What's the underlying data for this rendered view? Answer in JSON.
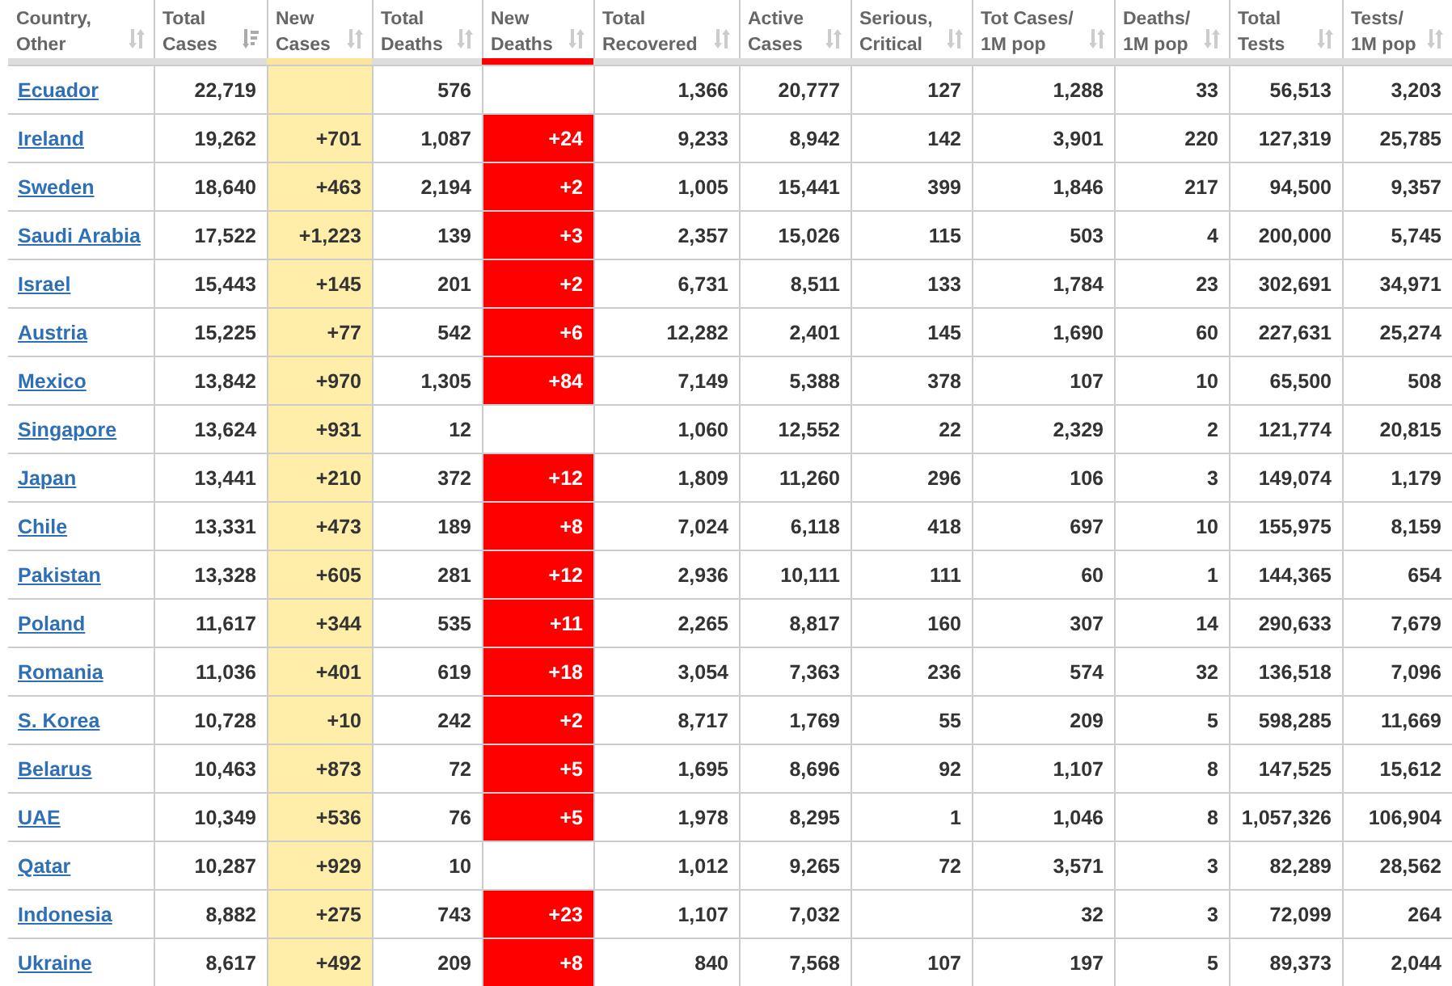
{
  "table": {
    "columns": [
      {
        "label": [
          "Country,",
          "Other"
        ],
        "kind": "country",
        "sorted": false
      },
      {
        "label": [
          "Total",
          "Cases"
        ],
        "kind": "number",
        "sorted": true
      },
      {
        "label": [
          "New",
          "Cases"
        ],
        "kind": "new_cases",
        "sorted": false
      },
      {
        "label": [
          "Total",
          "Deaths"
        ],
        "kind": "number",
        "sorted": false
      },
      {
        "label": [
          "New",
          "Deaths"
        ],
        "kind": "new_deaths",
        "sorted": false
      },
      {
        "label": [
          "Total",
          "Recovered"
        ],
        "kind": "number",
        "sorted": false
      },
      {
        "label": [
          "Active",
          "Cases"
        ],
        "kind": "number",
        "sorted": false
      },
      {
        "label": [
          "Serious,",
          "Critical"
        ],
        "kind": "number",
        "sorted": false
      },
      {
        "label": [
          "Tot Cases/",
          "1M pop"
        ],
        "kind": "number",
        "sorted": false
      },
      {
        "label": [
          "Deaths/",
          "1M pop"
        ],
        "kind": "number",
        "sorted": false
      },
      {
        "label": [
          "Total",
          "Tests"
        ],
        "kind": "number",
        "sorted": false
      },
      {
        "label": [
          "Tests/",
          "1M pop"
        ],
        "kind": "number",
        "sorted": false
      }
    ],
    "rows": [
      [
        "Ecuador",
        "22,719",
        null,
        "576",
        null,
        "1,366",
        "20,777",
        "127",
        "1,288",
        "33",
        "56,513",
        "3,203"
      ],
      [
        "Ireland",
        "19,262",
        "+701",
        "1,087",
        "+24",
        "9,233",
        "8,942",
        "142",
        "3,901",
        "220",
        "127,319",
        "25,785"
      ],
      [
        "Sweden",
        "18,640",
        "+463",
        "2,194",
        "+2",
        "1,005",
        "15,441",
        "399",
        "1,846",
        "217",
        "94,500",
        "9,357"
      ],
      [
        "Saudi Arabia",
        "17,522",
        "+1,223",
        "139",
        "+3",
        "2,357",
        "15,026",
        "115",
        "503",
        "4",
        "200,000",
        "5,745"
      ],
      [
        "Israel",
        "15,443",
        "+145",
        "201",
        "+2",
        "6,731",
        "8,511",
        "133",
        "1,784",
        "23",
        "302,691",
        "34,971"
      ],
      [
        "Austria",
        "15,225",
        "+77",
        "542",
        "+6",
        "12,282",
        "2,401",
        "145",
        "1,690",
        "60",
        "227,631",
        "25,274"
      ],
      [
        "Mexico",
        "13,842",
        "+970",
        "1,305",
        "+84",
        "7,149",
        "5,388",
        "378",
        "107",
        "10",
        "65,500",
        "508"
      ],
      [
        "Singapore",
        "13,624",
        "+931",
        "12",
        null,
        "1,060",
        "12,552",
        "22",
        "2,329",
        "2",
        "121,774",
        "20,815"
      ],
      [
        "Japan",
        "13,441",
        "+210",
        "372",
        "+12",
        "1,809",
        "11,260",
        "296",
        "106",
        "3",
        "149,074",
        "1,179"
      ],
      [
        "Chile",
        "13,331",
        "+473",
        "189",
        "+8",
        "7,024",
        "6,118",
        "418",
        "697",
        "10",
        "155,975",
        "8,159"
      ],
      [
        "Pakistan",
        "13,328",
        "+605",
        "281",
        "+12",
        "2,936",
        "10,111",
        "111",
        "60",
        "1",
        "144,365",
        "654"
      ],
      [
        "Poland",
        "11,617",
        "+344",
        "535",
        "+11",
        "2,265",
        "8,817",
        "160",
        "307",
        "14",
        "290,633",
        "7,679"
      ],
      [
        "Romania",
        "11,036",
        "+401",
        "619",
        "+18",
        "3,054",
        "7,363",
        "236",
        "574",
        "32",
        "136,518",
        "7,096"
      ],
      [
        "S. Korea",
        "10,728",
        "+10",
        "242",
        "+2",
        "8,717",
        "1,769",
        "55",
        "209",
        "5",
        "598,285",
        "11,669"
      ],
      [
        "Belarus",
        "10,463",
        "+873",
        "72",
        "+5",
        "1,695",
        "8,696",
        "92",
        "1,107",
        "8",
        "147,525",
        "15,612"
      ],
      [
        "UAE",
        "10,349",
        "+536",
        "76",
        "+5",
        "1,978",
        "8,295",
        "1",
        "1,046",
        "8",
        "1,057,326",
        "106,904"
      ],
      [
        "Qatar",
        "10,287",
        "+929",
        "10",
        null,
        "1,012",
        "9,265",
        "72",
        "3,571",
        "3",
        "82,289",
        "28,562"
      ],
      [
        "Indonesia",
        "8,882",
        "+275",
        "743",
        "+23",
        "1,107",
        "7,032",
        null,
        "32",
        "3",
        "72,099",
        "264"
      ],
      [
        "Ukraine",
        "8,617",
        "+492",
        "209",
        "+8",
        "840",
        "7,568",
        "107",
        "197",
        "5",
        "89,373",
        "2,044"
      ]
    ]
  }
}
